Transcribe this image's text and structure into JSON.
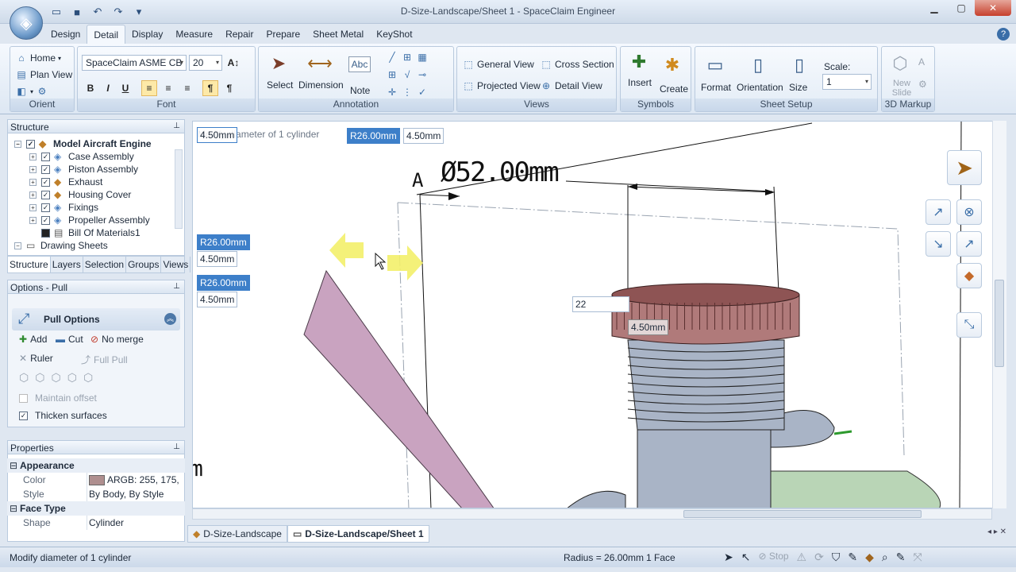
{
  "window": {
    "title": "D-Size-Landscape/Sheet 1 - SpaceClaim Engineer"
  },
  "ribbon_tabs": [
    "Design",
    "Detail",
    "Display",
    "Measure",
    "Repair",
    "Prepare",
    "Sheet Metal",
    "KeyShot"
  ],
  "ribbon": {
    "orient": {
      "label": "Orient",
      "home": "Home",
      "plan_view": "Plan View"
    },
    "font": {
      "label": "Font",
      "face": "SpaceClaim ASME CB",
      "size": "20",
      "bold": "B",
      "italic": "I",
      "underline": "U"
    },
    "annotation": {
      "label": "Annotation",
      "select": "Select",
      "dimension": "Dimension",
      "note": "Note",
      "note_icon": "Abc"
    },
    "views": {
      "label": "Views",
      "general": "General View",
      "cross": "Cross Section",
      "projected": "Projected View",
      "detail": "Detail View"
    },
    "symbols": {
      "label": "Symbols",
      "insert": "Insert",
      "create": "Create"
    },
    "sheet_setup": {
      "label": "Sheet Setup",
      "format": "Format",
      "orientation": "Orientation",
      "size": "Size",
      "scale_label": "Scale:",
      "scale_value": "1"
    },
    "markup": {
      "label": "3D Markup",
      "new_slide": "New Slide"
    }
  },
  "structure": {
    "title": "Structure",
    "items": [
      {
        "label": "Model Aircraft Engine",
        "bold": true
      },
      {
        "label": "Case Assembly"
      },
      {
        "label": "Piston Assembly"
      },
      {
        "label": "Exhaust"
      },
      {
        "label": "Housing Cover"
      },
      {
        "label": "Fixings"
      },
      {
        "label": "Propeller Assembly"
      },
      {
        "label": "Bill Of Materials1"
      },
      {
        "label": "Drawing Sheets"
      }
    ],
    "tabs": [
      "Structure",
      "Layers",
      "Selection",
      "Groups",
      "Views"
    ]
  },
  "options": {
    "title": "Options - Pull",
    "section": "Pull Options",
    "add": "Add",
    "cut": "Cut",
    "no_merge": "No merge",
    "ruler": "Ruler",
    "full_pull": "Full Pull",
    "maintain_offset": "Maintain offset",
    "thicken": "Thicken surfaces"
  },
  "properties": {
    "title": "Properties",
    "appearance": "Appearance",
    "color_k": "Color",
    "color_v": "ARGB: 255, 175,",
    "style_k": "Style",
    "style_v": "By Body, By Style",
    "face_type": "Face Type",
    "shape_k": "Shape",
    "shape_v": "Cylinder"
  },
  "viewport": {
    "hint": "Modify diameter of 1 cylinder",
    "hint_overlay": "4.50mm",
    "dim_top_r": "R26.00mm",
    "dim_top_v": "4.50mm",
    "dim_left1_r": "R26.00mm",
    "dim_left1_v": "4.50mm",
    "dim_left2_r": "R26.00mm",
    "dim_left2_v": "4.50mm",
    "diameter_label": "Ø52.00mm",
    "section_letter": "A",
    "input_value": "22",
    "tag_value": "4.50mm",
    "side_glyph": "m"
  },
  "sheet_tabs": [
    "D-Size-Landscape",
    "D-Size-Landscape/Sheet 1"
  ],
  "status": {
    "message": "Modify diameter of 1 cylinder",
    "radius": "Radius = 26.00mm",
    "faces": "1 Face",
    "stop": "Stop"
  },
  "colors": {
    "accent": "#3d7fc9",
    "prop_swatch": "#af8f8f",
    "engine_head": "#b07a7a",
    "cylinder": "#a9b4c6",
    "green_part": "#b9d5b6",
    "prop_blade": "#c9a3c0"
  }
}
